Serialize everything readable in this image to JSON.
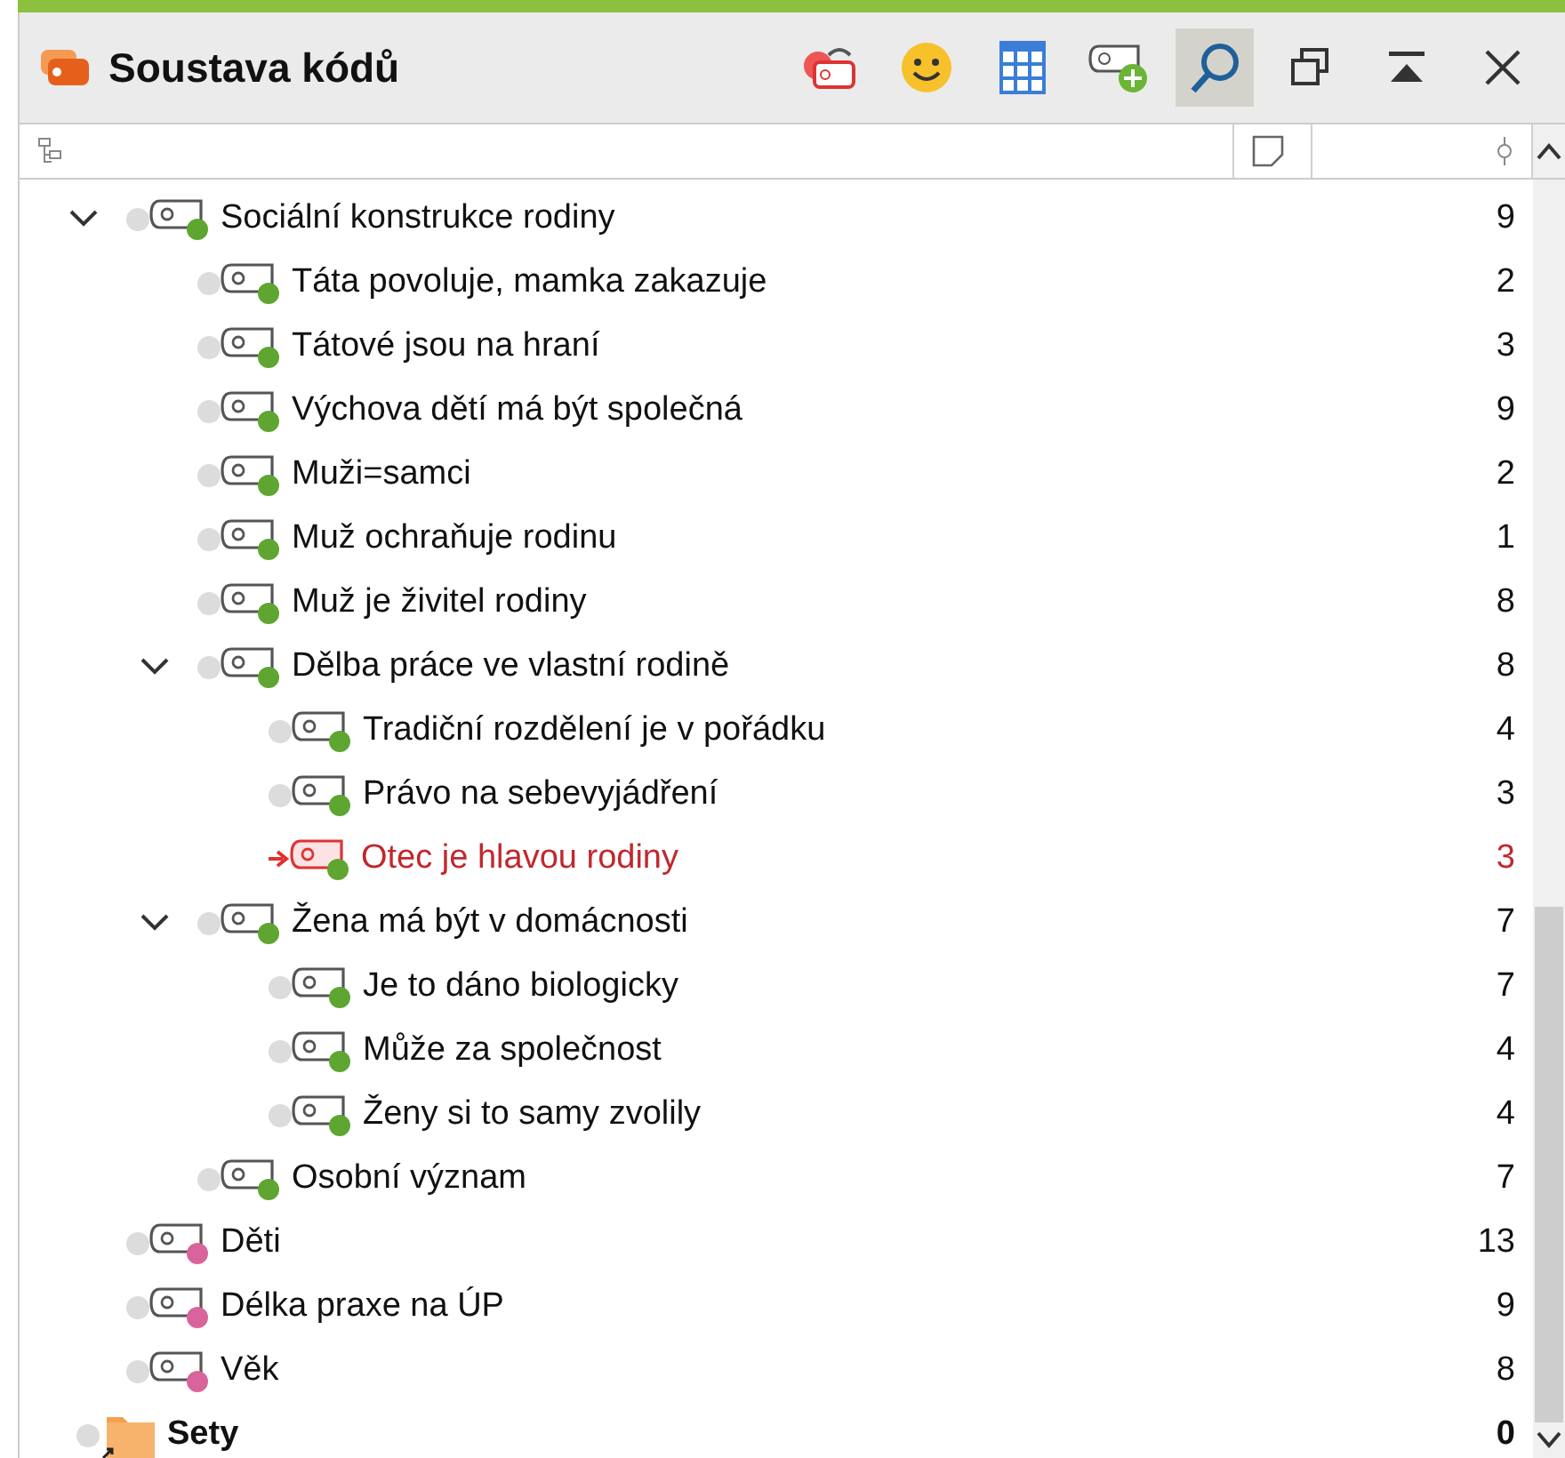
{
  "window": {
    "title": "Soustava kódů"
  },
  "toolbar": [
    {
      "kind": "undo-tag",
      "on": false
    },
    {
      "kind": "smiley",
      "on": false
    },
    {
      "kind": "table",
      "on": false
    },
    {
      "kind": "new-tag",
      "on": false
    },
    {
      "kind": "search",
      "on": true
    },
    {
      "kind": "restore",
      "on": false
    },
    {
      "kind": "collapse",
      "on": false
    },
    {
      "kind": "close",
      "on": false
    }
  ],
  "codes": [
    {
      "name": "Sociální konstrukce rodiny",
      "count": "9",
      "color": "#5ea631",
      "selected": false,
      "expanded": true,
      "children": [
        {
          "name": "Táta povoluje, mamka zakazuje",
          "count": "2",
          "color": "#5ea631",
          "selected": false
        },
        {
          "name": "Tátové jsou na hraní",
          "count": "3",
          "color": "#5ea631",
          "selected": false
        },
        {
          "name": "Výchova dětí má být společná",
          "count": "9",
          "color": "#5ea631",
          "selected": false
        },
        {
          "name": "Muži=samci",
          "count": "2",
          "color": "#5ea631",
          "selected": false
        },
        {
          "name": "Muž ochraňuje rodinu",
          "count": "1",
          "color": "#5ea631",
          "selected": false
        },
        {
          "name": "Muž je živitel rodiny",
          "count": "8",
          "color": "#5ea631",
          "selected": false
        },
        {
          "name": "Dělba práce ve vlastní rodině",
          "count": "8",
          "color": "#5ea631",
          "selected": false,
          "expanded": true,
          "children": [
            {
              "name": "Tradiční rozdělení je v pořádku",
              "count": "4",
              "color": "#5ea631",
              "selected": false
            },
            {
              "name": "Právo na sebevyjádření",
              "count": "3",
              "color": "#5ea631",
              "selected": false
            },
            {
              "name": "Otec je hlavou rodiny",
              "count": "3",
              "color": "#5ea631",
              "selected": true
            }
          ]
        },
        {
          "name": "Žena má být v domácnosti",
          "count": "7",
          "color": "#5ea631",
          "selected": false,
          "expanded": true,
          "children": [
            {
              "name": "Je to dáno biologicky",
              "count": "7",
              "color": "#5ea631",
              "selected": false
            },
            {
              "name": "Může za společnost",
              "count": "4",
              "color": "#5ea631",
              "selected": false
            },
            {
              "name": "Ženy si to samy zvolily",
              "count": "4",
              "color": "#5ea631",
              "selected": false
            }
          ]
        },
        {
          "name": "Osobní význam",
          "count": "7",
          "color": "#5ea631",
          "selected": false
        }
      ]
    },
    {
      "name": "Děti",
      "count": "13",
      "color": "#d9649c",
      "selected": false
    },
    {
      "name": "Délka praxe na ÚP",
      "count": "9",
      "color": "#d9649c",
      "selected": false
    },
    {
      "name": "Věk",
      "count": "8",
      "color": "#d9649c",
      "selected": false
    }
  ],
  "sets": {
    "name": "Sety",
    "count": "0"
  }
}
